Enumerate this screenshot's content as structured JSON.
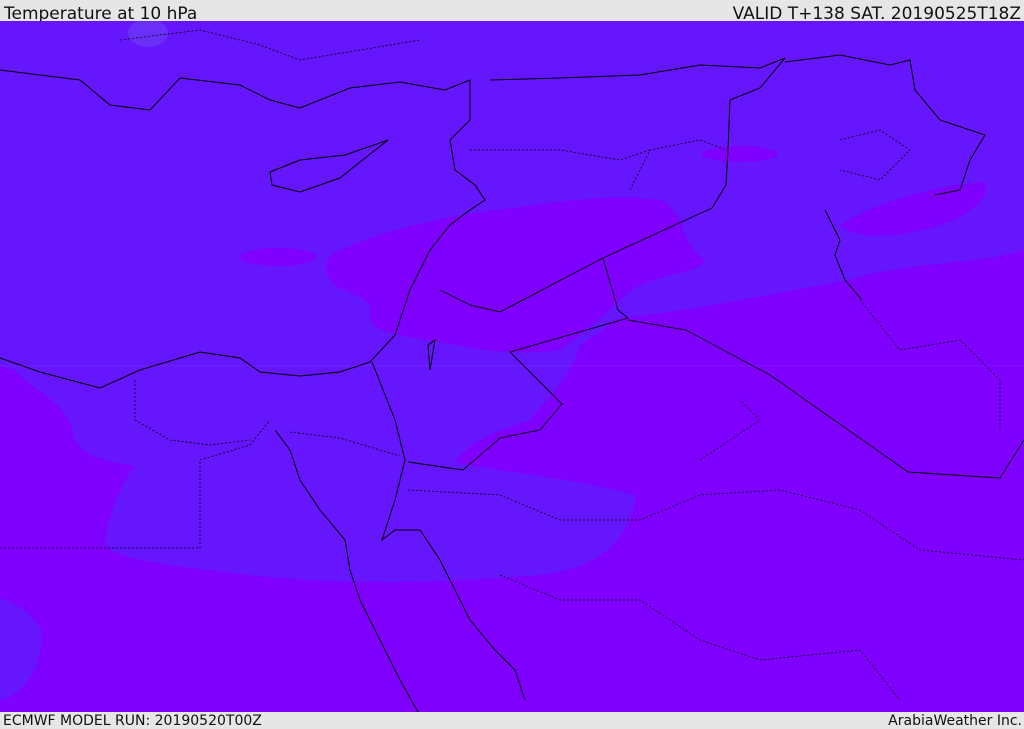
{
  "header": {
    "title": "Temperature at 10 hPa",
    "valid": "VALID T+138 SAT. 20190525T18Z"
  },
  "footer": {
    "model_run": "ECMWF MODEL RUN: 20190520T00Z",
    "credit": "ArabiaWeather Inc."
  },
  "colors": {
    "cold_band": "#6516fc",
    "warm_band": "#7f00fe",
    "coast": "#000000"
  }
}
